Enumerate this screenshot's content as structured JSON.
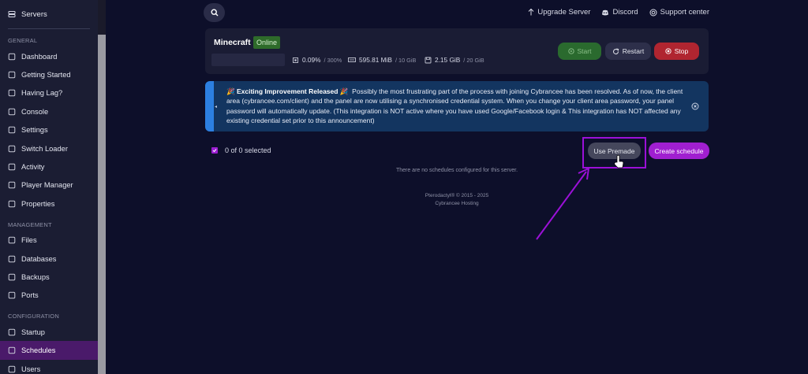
{
  "sidebar": {
    "top_item": "Servers",
    "sections": [
      {
        "heading": "GENERAL",
        "items": [
          {
            "label": "Dashboard",
            "icon": "dashboard-icon"
          },
          {
            "label": "Getting Started",
            "icon": "compass-icon"
          },
          {
            "label": "Having Lag?",
            "icon": "warning-icon"
          },
          {
            "label": "Console",
            "icon": "terminal-icon"
          },
          {
            "label": "Settings",
            "icon": "gear-icon"
          },
          {
            "label": "Switch Loader",
            "icon": "swap-icon"
          },
          {
            "label": "Activity",
            "icon": "eye-icon"
          },
          {
            "label": "Player Manager",
            "icon": "user-icon"
          },
          {
            "label": "Properties",
            "icon": "file-icon"
          }
        ]
      },
      {
        "heading": "MANAGEMENT",
        "items": [
          {
            "label": "Files",
            "icon": "folder-icon"
          },
          {
            "label": "Databases",
            "icon": "database-icon"
          },
          {
            "label": "Backups",
            "icon": "archive-icon"
          },
          {
            "label": "Ports",
            "icon": "network-icon"
          }
        ]
      },
      {
        "heading": "CONFIGURATION",
        "items": [
          {
            "label": "Startup",
            "icon": "rocket-icon"
          },
          {
            "label": "Schedules",
            "icon": "calendar-icon",
            "active": true
          },
          {
            "label": "Users",
            "icon": "users-icon"
          }
        ]
      }
    ]
  },
  "topnav": {
    "upgrade": "Upgrade Server",
    "discord": "Discord",
    "support": "Support center"
  },
  "server": {
    "name": "Minecraft",
    "status": "Online",
    "cpu": "0.09%",
    "cpu_limit": "/ 300%",
    "memory": "595.81 MiB",
    "memory_limit": "/ 10 GiB",
    "disk": "2.15 GiB",
    "disk_limit": "/ 20 GiB",
    "start_label": "Start",
    "restart_label": "Restart",
    "stop_label": "Stop"
  },
  "announcement": {
    "title": "Exciting Improvement Released",
    "body": "Possibly the most frustrating part of the process with joining Cybrancee has been resolved. As of now, the client area (cybrancee.com/client) and the panel are now utilising a synchronised credential system. When you change your client area password, your panel password will automatically update. (This integration is NOT active where you have used Google/Facebook login & This integration has NOT affected any existing credential set prior to this announcement)"
  },
  "schedules": {
    "selected_text": "0 of 0 selected",
    "use_premade_label": "Use Premade",
    "create_label": "Create schedule",
    "empty_message": "There are no schedules configured for this server."
  },
  "footer": {
    "line1": "Pterodactyl® © 2015 - 2025",
    "line2": "Cybrancee Hosting"
  },
  "colors": {
    "background": "#0d0f2a",
    "accent": "#a01fd0",
    "highlight": "#9b10d8",
    "announcement": "#133560"
  }
}
